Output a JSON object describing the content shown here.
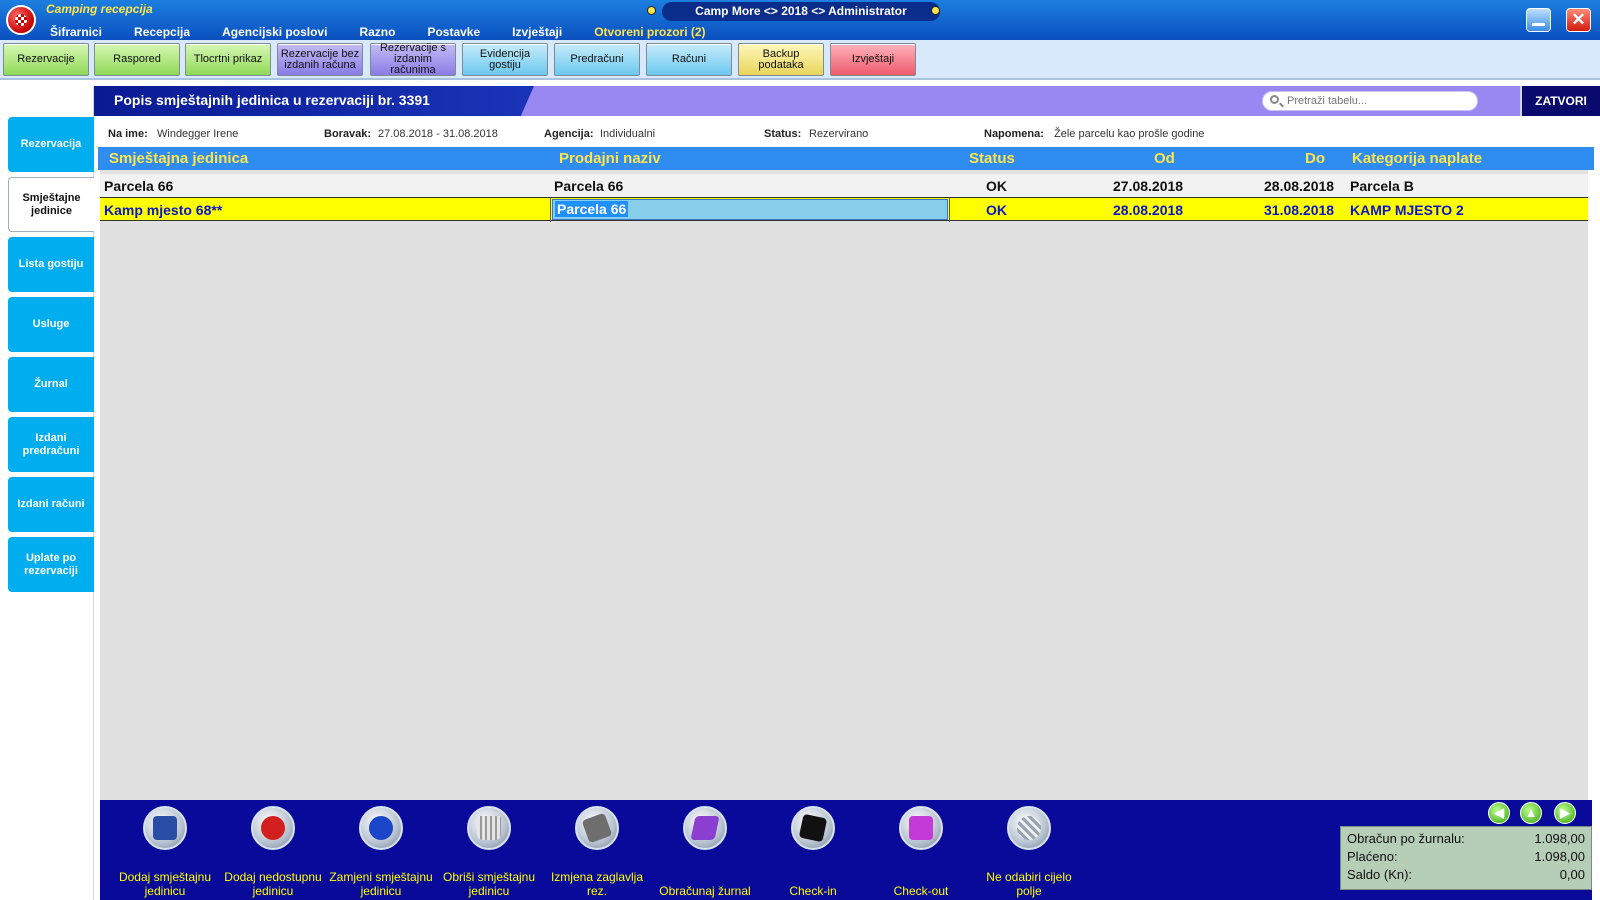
{
  "app": {
    "title": "Camping recepcija",
    "window_title": "Camp More <> 2018 <> Administrator"
  },
  "menu": [
    "Šifrarnici",
    "Recepcija",
    "Agencijski poslovi",
    "Razno",
    "Postavke",
    "Izvještaji",
    "Otvoreni prozori (2)"
  ],
  "toolbar": [
    {
      "label": "Rezervacije",
      "color": "green"
    },
    {
      "label": "Raspored",
      "color": "green"
    },
    {
      "label": "Tlocrtni prikaz",
      "color": "green"
    },
    {
      "label": "Rezervacije bez izdanih računa",
      "color": "purple"
    },
    {
      "label": "Rezervacije s izdanim računima",
      "color": "purple"
    },
    {
      "label": "Evidencija gostiju",
      "color": "blue"
    },
    {
      "label": "Predračuni",
      "color": "blue"
    },
    {
      "label": "Računi",
      "color": "blue"
    },
    {
      "label": "Backup podataka",
      "color": "yellow"
    },
    {
      "label": "Izvještaji",
      "color": "red"
    }
  ],
  "leftnav": [
    {
      "label": "Rezervacija",
      "active": false
    },
    {
      "label": "Smještajne jedinice",
      "active": true
    },
    {
      "label": "Lista gostiju",
      "active": false
    },
    {
      "label": "Usluge",
      "active": false
    },
    {
      "label": "Žurnal",
      "active": false
    },
    {
      "label": "Izdani predračuni",
      "active": false
    },
    {
      "label": "Izdani računi",
      "active": false
    },
    {
      "label": "Uplate po rezervaciji",
      "active": false
    }
  ],
  "panel": {
    "title": "Popis smještajnih jedinica u rezervaciji br. 3391",
    "search_placeholder": "Pretraži tabelu...",
    "close_label": "ZATVORI"
  },
  "info": {
    "name_label": "Na ime:",
    "name_value": "Windegger Irene",
    "stay_label": "Boravak:",
    "stay_value": "27.08.2018 - 31.08.2018",
    "agency_label": "Agencija:",
    "agency_value": "Individualni",
    "status_label": "Status:",
    "status_value": "Rezervirano",
    "note_label": "Napomena:",
    "note_value": "Žele parcelu kao prošle godine"
  },
  "table": {
    "columns": [
      "Smještajna jedinica",
      "Prodajni naziv",
      "Status",
      "Od",
      "Do",
      "Kategorija naplate"
    ],
    "rows": [
      [
        "Parcela 66",
        "Parcela 66",
        "OK",
        "27.08.2018",
        "28.08.2018",
        "Parcela B"
      ],
      [
        "Kamp mjesto 68**",
        "Parcela 66",
        "OK",
        "28.08.2018",
        "31.08.2018",
        "KAMP MJESTO 2"
      ]
    ]
  },
  "actions": [
    {
      "label": "Dodaj smještajnu jedinicu",
      "icon": "document-icon",
      "color": "#2a4ea8"
    },
    {
      "label": "Dodaj nedostupnu jedinicu",
      "icon": "stop-hand-icon",
      "color": "#d21f1f"
    },
    {
      "label": "Zamjeni smještajnu jedinicu",
      "icon": "swap-icon",
      "color": "#1b46c9"
    },
    {
      "label": "Obriši smještajnu jedinicu",
      "icon": "trash-icon",
      "color": "#c9c9c9"
    },
    {
      "label": "Izmjena zaglavlja rez.",
      "icon": "edit-icon",
      "color": "#6e6e6e"
    },
    {
      "label": "Obračunaj žurnal",
      "icon": "journal-icon",
      "color": "#8a3fd0"
    },
    {
      "label": "Check-in",
      "icon": "checkin-icon",
      "color": "#111111"
    },
    {
      "label": "Check-out",
      "icon": "gift-icon",
      "color": "#c33bd6"
    },
    {
      "label": "Ne odabiri cijelo polje",
      "icon": "grid-icon",
      "color": "#9aa3ad"
    }
  ],
  "summary": {
    "rows": [
      {
        "label": "Obračun po žurnalu:",
        "value": "1.098,00"
      },
      {
        "label": "Plaćeno:",
        "value": "1.098,00"
      },
      {
        "label": "Saldo (Kn):",
        "value": "0,00"
      }
    ]
  }
}
